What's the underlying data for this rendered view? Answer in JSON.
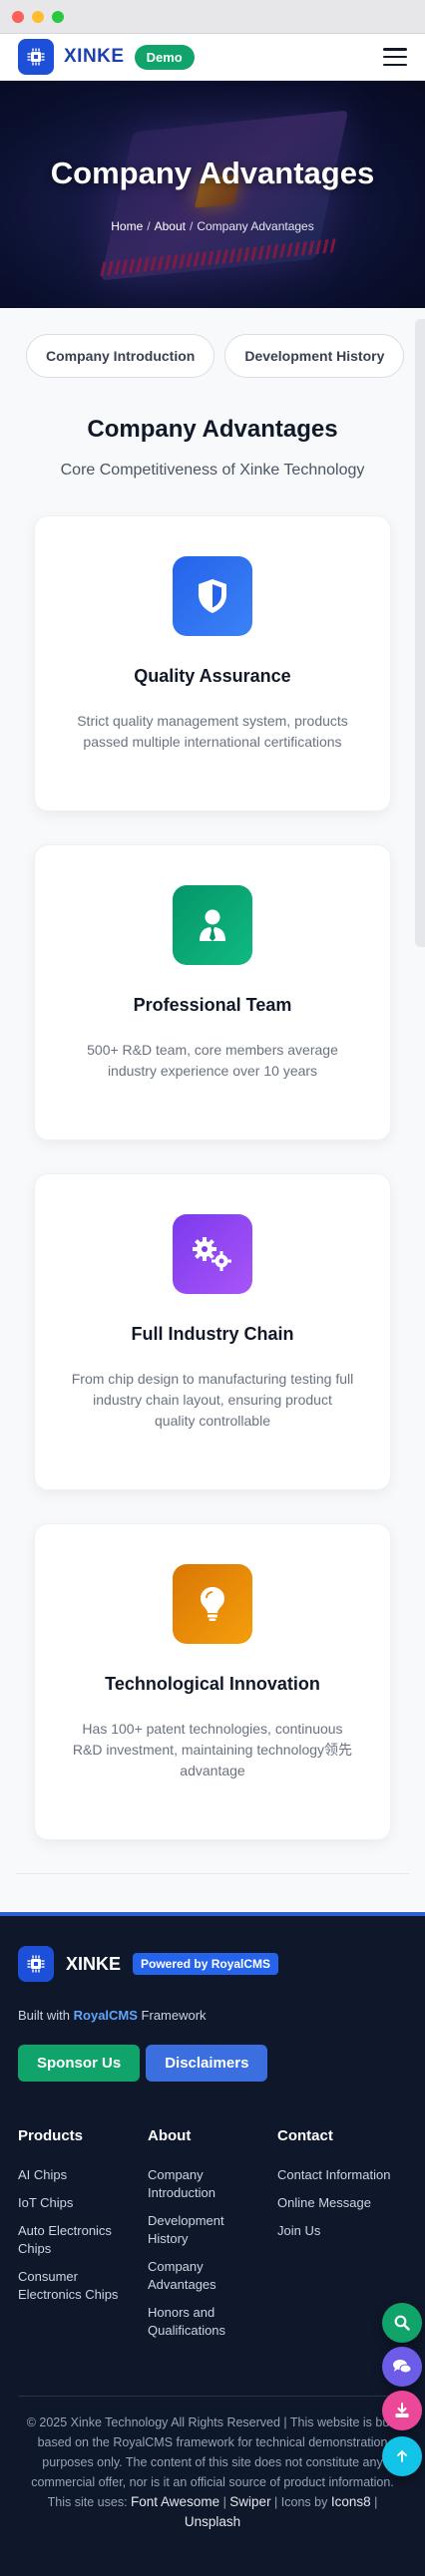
{
  "navbar": {
    "logo_text": "XINKE",
    "demo_badge": "Demo"
  },
  "hero": {
    "title": "Company Advantages",
    "breadcrumb": [
      "Home",
      "About",
      "Company Advantages"
    ],
    "separator": "/"
  },
  "tabs": [
    "Company Introduction",
    "Development History"
  ],
  "section": {
    "title": "Company Advantages",
    "subtitle": "Core Competitiveness of Xinke Technology"
  },
  "cards": [
    {
      "icon": "shield-icon",
      "color_from": "#2563eb",
      "color_to": "#3b82f6",
      "title": "Quality Assurance",
      "desc": "Strict quality management system, products passed multiple international certifications"
    },
    {
      "icon": "user-tie-icon",
      "color_from": "#059669",
      "color_to": "#10b981",
      "title": "Professional Team",
      "desc": "500+ R&D team, core members average industry experience over 10 years"
    },
    {
      "icon": "gears-icon",
      "color_from": "#7c3aed",
      "color_to": "#a855f7",
      "title": "Full Industry Chain",
      "desc": "From chip design to manufacturing testing full industry chain layout, ensuring product quality controllable"
    },
    {
      "icon": "lightbulb-icon",
      "color_from": "#d97706",
      "color_to": "#f59e0b",
      "title": "Technological Innovation",
      "desc": "Has 100+ patent technologies, continuous R&D investment, maintaining technology领先 advantage"
    }
  ],
  "footer": {
    "brand": "XINKE",
    "powered": "Powered by RoyalCMS",
    "built_prefix": "Built with ",
    "built_link": "RoyalCMS",
    "built_suffix": " Framework",
    "sponsor_label": "Sponsor Us",
    "disclaimer_label": "Disclaimers",
    "columns": [
      {
        "title": "Products",
        "links": [
          "AI Chips",
          "IoT Chips",
          "Auto Electronics Chips",
          "Consumer Electronics Chips"
        ]
      },
      {
        "title": "About",
        "links": [
          "Company Introduction",
          "Development History",
          "Company Advantages",
          "Honors and Qualifications"
        ]
      },
      {
        "title": "Contact",
        "links": [
          "Contact Information",
          "Online Message",
          "Join Us"
        ]
      }
    ],
    "copyright": "© 2025 Xinke Technology All Rights Reserved | This website is built based on the RoyalCMS framework for technical demonstration purposes only. The content of this site does not constitute any commercial offer, nor is it an official source of product information.",
    "uses_prefix": "This site uses:",
    "uses_font_awesome": "Font Awesome",
    "uses_swiper": "Swiper",
    "uses_icons_prefix": "Icons by",
    "uses_icons8": "Icons8",
    "uses_unsplash": "Unsplash"
  },
  "fabs": [
    "search-icon",
    "chat-icon",
    "download-icon",
    "arrow-up-icon"
  ],
  "colors": {
    "brand_blue": "#1e4fd8",
    "accent_green": "#10a46b",
    "footer_bg": "#0f172a"
  }
}
